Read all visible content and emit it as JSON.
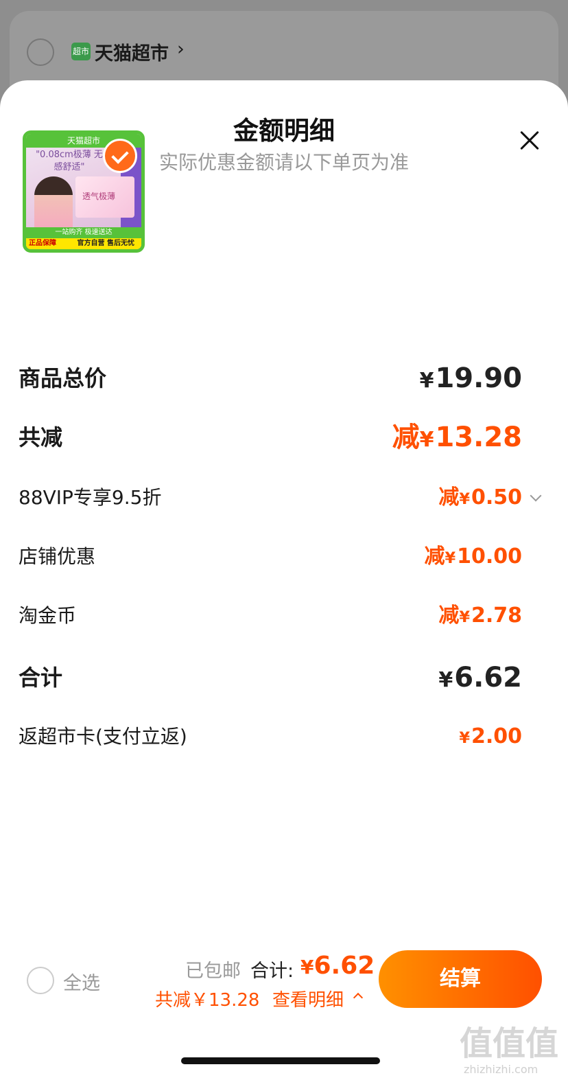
{
  "store": {
    "logo_text": "超市",
    "name": "天猫超市"
  },
  "sheet": {
    "title": "金额明细",
    "subtitle": "实际优惠金额请以下单页为准"
  },
  "product": {
    "banner": "天猫超市",
    "tagline": "\"0.08cm极薄 无感舒适\"",
    "box_label": "透气极薄",
    "footer1": "一站购齐 极速送达",
    "footer2": "官方自营 售后无忧",
    "seal": "正品保障"
  },
  "rows": [
    {
      "label": "商品总价",
      "value": "19.90",
      "prefix": "",
      "currency": "¥"
    },
    {
      "label": "共减",
      "value": "13.28",
      "prefix": "减",
      "currency": "¥"
    },
    {
      "label": "88VIP专享9.5折",
      "value": "0.50",
      "prefix": "减",
      "currency": "¥"
    },
    {
      "label": "店铺优惠",
      "value": "10.00",
      "prefix": "减",
      "currency": "¥"
    },
    {
      "label": "淘金币",
      "value": "2.78",
      "prefix": "减",
      "currency": "¥"
    },
    {
      "label": "合计",
      "value": "6.62",
      "prefix": "",
      "currency": "¥"
    },
    {
      "label": "返超市卡(支付立返)",
      "value": "2.00",
      "prefix": "",
      "currency": "¥"
    }
  ],
  "bottom_bar": {
    "select_all": "全选",
    "shipping": "已包邮",
    "total_label": "合计:",
    "total_currency": "¥",
    "total_amount": "6.62",
    "discount_text": "共减￥13.28",
    "detail_link": "查看明细",
    "checkout": "结算"
  },
  "watermark": {
    "mark": "值值值",
    "site": "zhizhizhi.com"
  },
  "colors": {
    "accent": "#ff5000",
    "button_gradient_start": "#ff9000",
    "green_brand": "#57c23a"
  }
}
